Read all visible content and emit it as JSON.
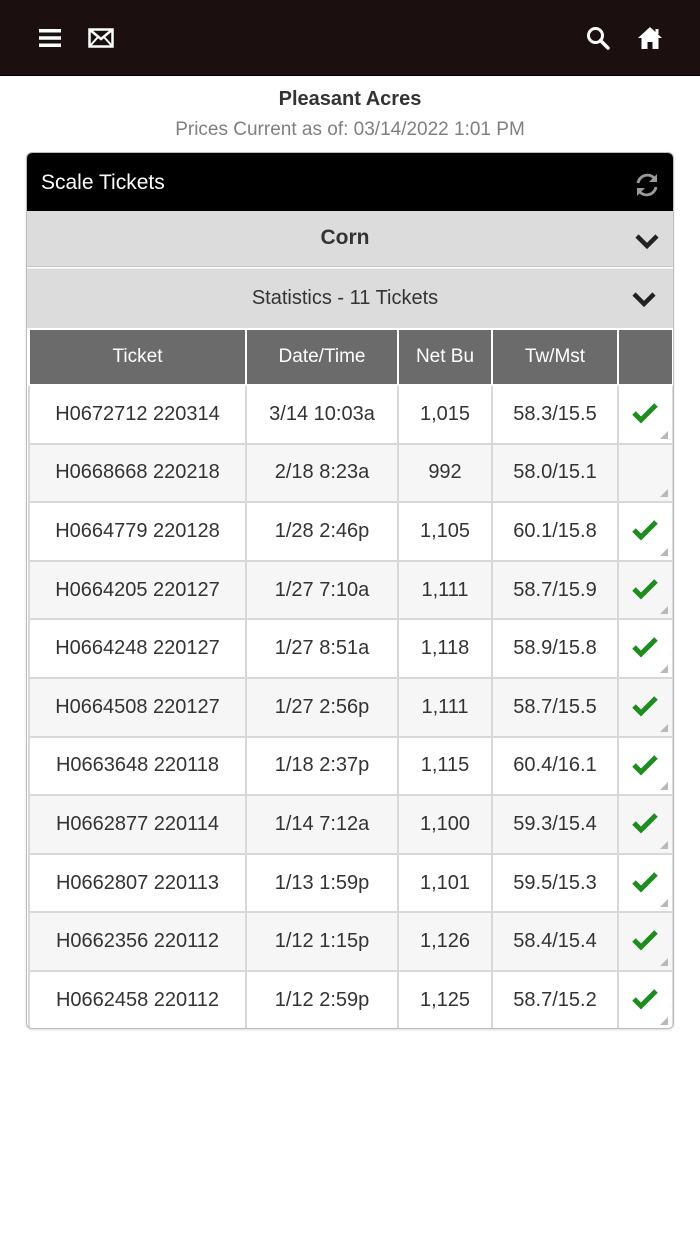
{
  "topbar": {
    "icons": [
      "menu-icon",
      "mail-icon",
      "search-icon",
      "home-icon"
    ],
    "background": "#1c0f0f"
  },
  "farm_name": "Pleasant Acres",
  "prices_current": "Prices Current as of: 03/14/2022 1:01 PM",
  "panel": {
    "title": "Scale Tickets",
    "refresh_icon": "refresh-icon",
    "crop": "Corn",
    "statistics": "Statistics - 11 Tickets"
  },
  "table": {
    "headers": [
      "Ticket",
      "Date/Time",
      "Net Bu",
      "Tw/Mst",
      ""
    ],
    "rows": [
      {
        "ticket": "H0672712 220314",
        "datetime": "3/14 10:03a",
        "net_bu": "1,015",
        "tw_mst": "58.3/15.5",
        "checked": true
      },
      {
        "ticket": "H0668668 220218",
        "datetime": "2/18 8:23a",
        "net_bu": "992",
        "tw_mst": "58.0/15.1",
        "checked": false
      },
      {
        "ticket": "H0664779 220128",
        "datetime": "1/28 2:46p",
        "net_bu": "1,105",
        "tw_mst": "60.1/15.8",
        "checked": true
      },
      {
        "ticket": "H0664205 220127",
        "datetime": "1/27 7:10a",
        "net_bu": "1,111",
        "tw_mst": "58.7/15.9",
        "checked": true
      },
      {
        "ticket": "H0664248 220127",
        "datetime": "1/27 8:51a",
        "net_bu": "1,118",
        "tw_mst": "58.9/15.8",
        "checked": true
      },
      {
        "ticket": "H0664508 220127",
        "datetime": "1/27 2:56p",
        "net_bu": "1,111",
        "tw_mst": "58.7/15.5",
        "checked": true
      },
      {
        "ticket": "H0663648 220118",
        "datetime": "1/18 2:37p",
        "net_bu": "1,115",
        "tw_mst": "60.4/16.1",
        "checked": true
      },
      {
        "ticket": "H0662877 220114",
        "datetime": "1/14 7:12a",
        "net_bu": "1,100",
        "tw_mst": "59.3/15.4",
        "checked": true
      },
      {
        "ticket": "H0662807 220113",
        "datetime": "1/13 1:59p",
        "net_bu": "1,101",
        "tw_mst": "59.5/15.3",
        "checked": true
      },
      {
        "ticket": "H0662356 220112",
        "datetime": "1/12 1:15p",
        "net_bu": "1,126",
        "tw_mst": "58.4/15.4",
        "checked": true
      },
      {
        "ticket": "H0662458 220112",
        "datetime": "1/12 2:59p",
        "net_bu": "1,125",
        "tw_mst": "58.7/15.2",
        "checked": true
      }
    ]
  },
  "colors": {
    "header_bg": "#000000",
    "accordion_bg": "#dcdcdc",
    "table_header_bg": "#6b6b6b",
    "check_green": "#1e8c1e"
  }
}
